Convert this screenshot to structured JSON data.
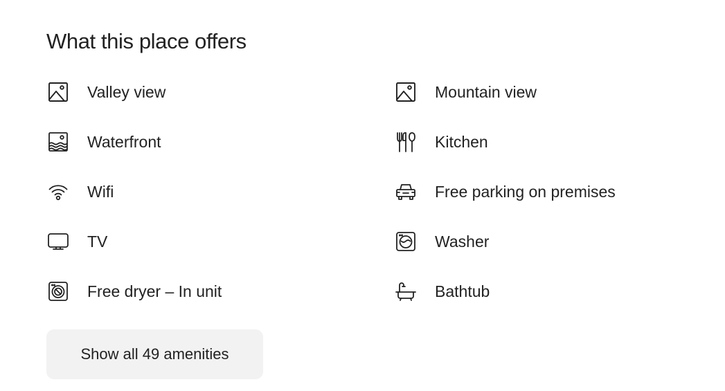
{
  "section": {
    "title": "What this place offers"
  },
  "amenities": [
    {
      "label": "Valley view",
      "icon": "landscape-view-icon"
    },
    {
      "label": "Mountain view",
      "icon": "landscape-view-icon"
    },
    {
      "label": "Waterfront",
      "icon": "waterfront-icon"
    },
    {
      "label": "Kitchen",
      "icon": "kitchen-utensils-icon"
    },
    {
      "label": "Wifi",
      "icon": "wifi-icon"
    },
    {
      "label": "Free parking on premises",
      "icon": "car-icon"
    },
    {
      "label": "TV",
      "icon": "tv-icon"
    },
    {
      "label": "Washer",
      "icon": "washer-icon"
    },
    {
      "label": "Free dryer – In unit",
      "icon": "dryer-icon"
    },
    {
      "label": "Bathtub",
      "icon": "bathtub-icon"
    }
  ],
  "show_all_button": {
    "label": "Show all 49 amenities"
  },
  "colors": {
    "text": "#222222",
    "button_bg": "#f2f2f2",
    "background": "#ffffff"
  }
}
